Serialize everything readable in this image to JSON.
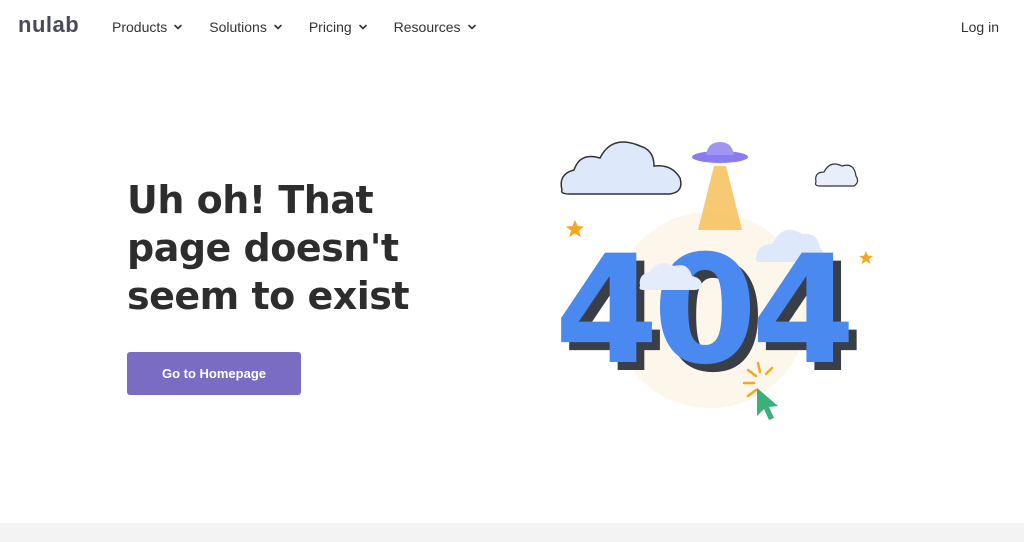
{
  "nav": {
    "logo": "nulab",
    "items": [
      {
        "label": "Products"
      },
      {
        "label": "Solutions"
      },
      {
        "label": "Pricing"
      },
      {
        "label": "Resources"
      }
    ],
    "login": "Log in"
  },
  "hero": {
    "headline": "Uh oh! That page doesn't seem to exist",
    "button": "Go to Homepage"
  },
  "illustration": {
    "text": "404",
    "colors": {
      "digits": "#4a8af0",
      "shadow": "#3a3f47",
      "ufo": "#8a7cf0",
      "beam": "#f7c364",
      "star": "#f5a623",
      "cursor": "#3bb07a",
      "cloud": "#dde9fb",
      "glow": "#fdf6ea"
    }
  },
  "colors": {
    "button": "#7b6cc3",
    "footer": "#f3f3f4"
  }
}
